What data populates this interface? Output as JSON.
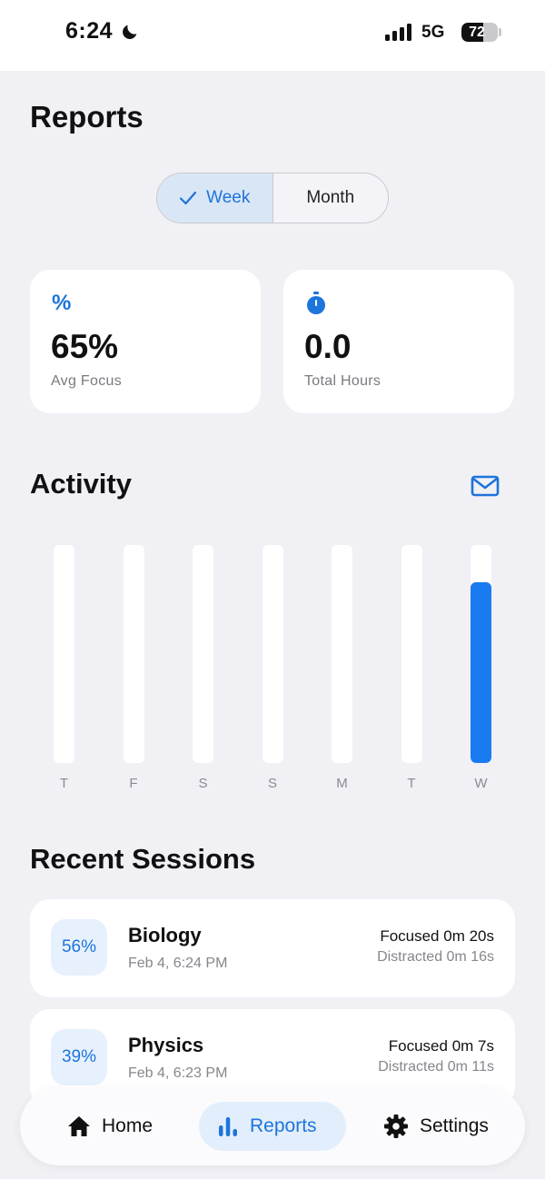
{
  "status_bar": {
    "time": "6:24",
    "network": "5G",
    "battery_level": "72"
  },
  "page": {
    "title": "Reports"
  },
  "period_toggle": {
    "options": [
      {
        "label": "Week",
        "selected": true
      },
      {
        "label": "Month",
        "selected": false
      }
    ]
  },
  "stats": {
    "avg_focus": {
      "value": "65%",
      "label": "Avg Focus",
      "icon": "percent-icon"
    },
    "total_hours": {
      "value": "0.0",
      "label": "Total Hours",
      "icon": "stopwatch-icon"
    }
  },
  "activity": {
    "title": "Activity",
    "action_icon": "mail-icon",
    "accent_color": "#1a7af0"
  },
  "chart_data": {
    "type": "bar",
    "categories": [
      "T",
      "F",
      "S",
      "S",
      "M",
      "T",
      "W"
    ],
    "values": [
      0,
      0,
      0,
      0,
      0,
      0,
      0.83
    ],
    "ylim": [
      0,
      1
    ],
    "grid": false
  },
  "recent_sessions": {
    "title": "Recent Sessions",
    "items": [
      {
        "percent": "56%",
        "subject": "Biology",
        "date": "Feb 4, 6:24 PM",
        "focused": "Focused 0m 20s",
        "distracted": "Distracted 0m 16s"
      },
      {
        "percent": "39%",
        "subject": "Physics",
        "date": "Feb 4, 6:23 PM",
        "focused": "Focused 0m 7s",
        "distracted": "Distracted 0m 11s"
      }
    ]
  },
  "tab_bar": {
    "tabs": [
      {
        "label": "Home",
        "icon": "home-icon",
        "active": false
      },
      {
        "label": "Reports",
        "icon": "bar-chart-icon",
        "active": true
      },
      {
        "label": "Settings",
        "icon": "gear-icon",
        "active": false
      }
    ]
  }
}
